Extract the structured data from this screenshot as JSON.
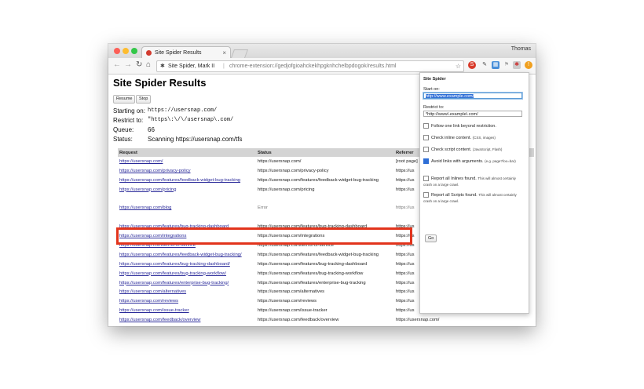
{
  "window": {
    "user": "Thomas"
  },
  "tab": {
    "title": "Site Spider Results",
    "close": "×"
  },
  "toolbar": {
    "back": "←",
    "forward": "→",
    "reload": "↻",
    "omnibox_name": "Site Spider, Mark II",
    "omnibox_sep": "|",
    "omnibox_url": "chrome-extension://gedjofgioahckekhpgknhchelbpdogok/results.html",
    "star": "☆"
  },
  "page": {
    "title": "Site Spider Results",
    "resume_label": "Resume",
    "stop_label": "Stop",
    "starting_on_label": "Starting on:",
    "starting_on_value": "https://usersnap.com/",
    "restrict_label": "Restrict to:",
    "restrict_value": "\"https\\:\\/\\/usersnap\\.com/",
    "queue_label": "Queue:",
    "queue_value": "66",
    "status_label": "Status:",
    "status_value": "Scanning https://usersnap.com/tfs"
  },
  "table": {
    "headers": {
      "request": "Request",
      "status": "Status",
      "referrer": "Referrer"
    },
    "rows": [
      {
        "request": "https://usersnap.com/",
        "status": "https://usersnap.com/",
        "referrer": "[root page]"
      },
      {
        "request": "https://usersnap.com/privacy-policy",
        "status": "https://usersnap.com/privacy-policy",
        "referrer": "https://us"
      },
      {
        "request": "https://usersnap.com/features/feedback-widget-bug-tracking",
        "status": "https://usersnap.com/features/feedback-widget-bug-tracking",
        "referrer": "https://us"
      },
      {
        "request": "https://usersnap.com/pricing",
        "status": "https://usersnap.com/pricing",
        "referrer": "https://us"
      },
      {
        "request": "",
        "status": "",
        "referrer": ""
      },
      {
        "request": "https://usersnap.com/blog",
        "status": "Error",
        "referrer": "https://us",
        "error": true
      },
      {
        "request": "",
        "status": "",
        "referrer": ""
      },
      {
        "request": "https://usersnap.com/features/bug-tracking-dashboard",
        "status": "https://usersnap.com/features/bug-tracking-dashboard",
        "referrer": "https://us"
      },
      {
        "request": "https://usersnap.com/integrations",
        "status": "https://usersnap.com/integrations",
        "referrer": "https://us"
      },
      {
        "request": "https://usersnap.com/terms-of-service",
        "status": "https://usersnap.com/terms-of-service",
        "referrer": "https://us"
      },
      {
        "request": "https://usersnap.com/features/feedback-widget-bug-tracking/",
        "status": "https://usersnap.com/features/feedback-widget-bug-tracking",
        "referrer": "https://us"
      },
      {
        "request": "https://usersnap.com/features/bug-tracking-dashboard/",
        "status": "https://usersnap.com/features/bug-tracking-dashboard",
        "referrer": "https://us"
      },
      {
        "request": "https://usersnap.com/features/bug-tracking-workflow/",
        "status": "https://usersnap.com/features/bug-tracking-workflow",
        "referrer": "https://us"
      },
      {
        "request": "https://usersnap.com/features/enterprise-bug-tracking/",
        "status": "https://usersnap.com/features/enterprise-bug-tracking",
        "referrer": "https://us"
      },
      {
        "request": "https://usersnap.com/alternatives",
        "status": "https://usersnap.com/alternatives",
        "referrer": "https://us"
      },
      {
        "request": "https://usersnap.com/reviews",
        "status": "https://usersnap.com/reviews",
        "referrer": "https://us"
      },
      {
        "request": "https://usersnap.com/issue-tracker",
        "status": "https://usersnap.com/issue-tracker",
        "referrer": "https://us"
      },
      {
        "request": "https://usersnap.com/feedback/overview",
        "status": "https://usersnap.com/feedback/overview",
        "referrer": "https://usersnap.com/"
      }
    ]
  },
  "popup": {
    "title": "Site Spider",
    "start_label": "Start on:",
    "start_value": "http://www.example.com/",
    "restrict_label": "Restrict to:",
    "restrict_value": "*http://www\\.example\\.com/",
    "opt1": "Follow one link beyond restriction.",
    "opt2": "Check inline content.",
    "opt2_note": "(CSS, images)",
    "opt3": "Check script content.",
    "opt3_note": "(JavaScript, Flash)",
    "opt4": "Avoid links with arguments.",
    "opt4_note": "(e.g. page?foo=bar)",
    "opt5": "Report all Inlines found.",
    "opt5_note": "This will almost certainly crash on a large crawl.",
    "opt6": "Report all Scripts found.",
    "opt6_note": "This will almost certainly crash on a large crawl.",
    "go_label": "Go"
  },
  "colors": {
    "highlight": "#e2341c",
    "link": "#2a2a9a"
  }
}
